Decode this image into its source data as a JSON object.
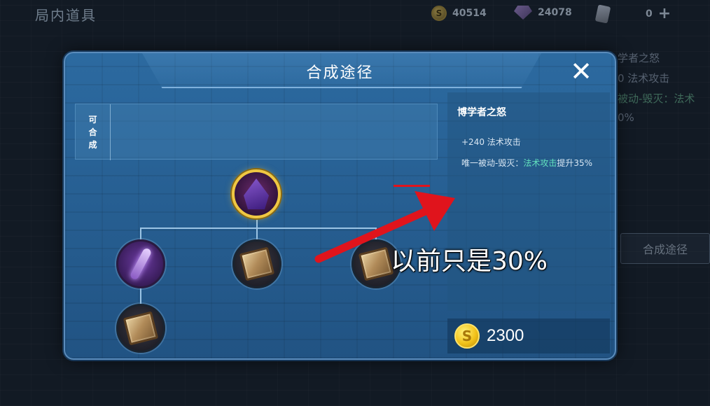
{
  "topbar": {
    "title": "局内道具",
    "gold": "40514",
    "diamonds": "24078",
    "cards": "0"
  },
  "background": {
    "side_lines": [
      "学者之怒",
      "0 法术攻击",
      "被动-毁灭：法术",
      "0%"
    ],
    "compose_button": "合成途径"
  },
  "modal": {
    "title": "合成途径",
    "close_glyph": "✕",
    "composable_label": [
      "可",
      "合",
      "成"
    ],
    "item": {
      "name": "博学者之怒",
      "stat": "+240 法术攻击",
      "passive_prefix": "唯一被动-毁灭：",
      "passive_highlight": "法术攻击",
      "passive_suffix": "提升35%",
      "price": "2300"
    },
    "coin_symbol": "S"
  },
  "annotation": {
    "text": "以前只是30%",
    "color": "#e0141c"
  }
}
